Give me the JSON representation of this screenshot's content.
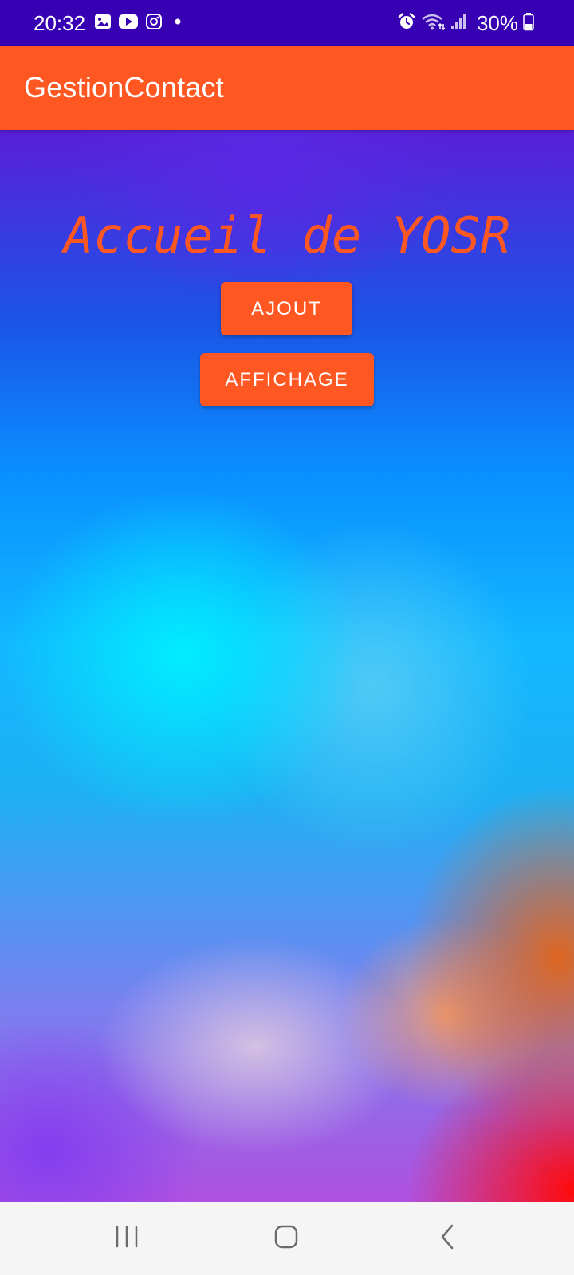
{
  "status_bar": {
    "time": "20:32",
    "left_icons": [
      "gallery-icon",
      "youtube-icon",
      "instagram-icon",
      "dot-icon"
    ],
    "right_icons": [
      "alarm-icon",
      "wifi-icon",
      "signal-icon",
      "battery-icon"
    ],
    "battery_percent": "30%",
    "background_color": "#3700b3"
  },
  "app_bar": {
    "title": "GestionContact",
    "background_color": "#ff5722"
  },
  "main": {
    "heading": "Accueil de YOSR",
    "buttons": {
      "ajout_label": "AJOUT",
      "affichage_label": "AFFICHAGE"
    },
    "accent_color": "#ff5722"
  },
  "nav_bar": {
    "buttons": [
      "recents-icon",
      "home-icon",
      "back-icon"
    ]
  }
}
